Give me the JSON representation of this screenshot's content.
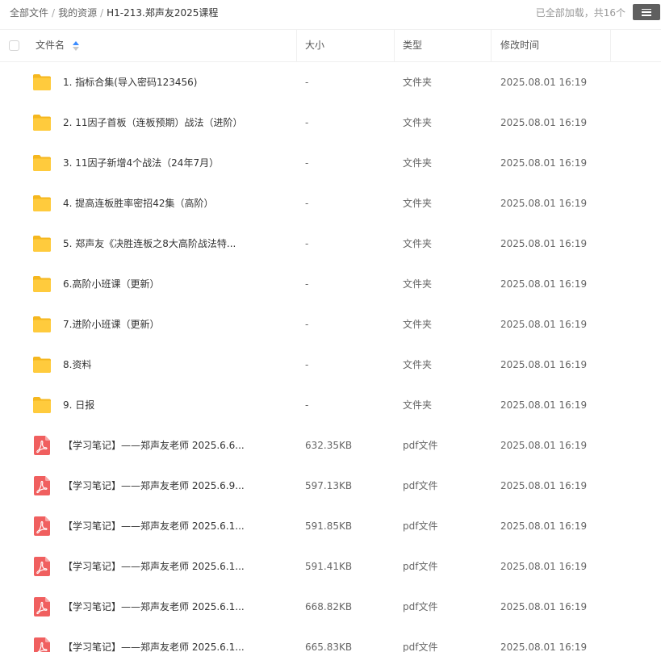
{
  "breadcrumb": {
    "items": [
      "全部文件",
      "我的资源"
    ],
    "current": "H1-213.郑声友2025课程",
    "separator": "/"
  },
  "status": {
    "text": "已全部加载，共16个"
  },
  "menu_icon": "hamburger-menu-icon",
  "columns": {
    "name": "文件名",
    "size": "大小",
    "type": "类型",
    "mtime": "修改时间"
  },
  "colors": {
    "folder": "#ffcb3d",
    "pdf": "#f05f5f",
    "sort_accent": "#3b8cff"
  },
  "files": [
    {
      "icon": "folder-icon",
      "name": "1. 指标合集(导入密码123456)",
      "size": "-",
      "type": "文件夹",
      "mtime": "2025.08.01 16:19"
    },
    {
      "icon": "folder-icon",
      "name": "2. 11因子首板（连板预期）战法（进阶）",
      "size": "-",
      "type": "文件夹",
      "mtime": "2025.08.01 16:19"
    },
    {
      "icon": "folder-icon",
      "name": "3. 11因子新增4个战法（24年7月）",
      "size": "-",
      "type": "文件夹",
      "mtime": "2025.08.01 16:19"
    },
    {
      "icon": "folder-icon",
      "name": "4. 提高连板胜率密招42集（高阶）",
      "size": "-",
      "type": "文件夹",
      "mtime": "2025.08.01 16:19"
    },
    {
      "icon": "folder-icon",
      "name": "5. 郑声友《决胜连板之8大高阶战法特...",
      "size": "-",
      "type": "文件夹",
      "mtime": "2025.08.01 16:19"
    },
    {
      "icon": "folder-icon",
      "name": "6.高阶小班课（更新）",
      "size": "-",
      "type": "文件夹",
      "mtime": "2025.08.01 16:19"
    },
    {
      "icon": "folder-icon",
      "name": "7.进阶小班课（更新）",
      "size": "-",
      "type": "文件夹",
      "mtime": "2025.08.01 16:19"
    },
    {
      "icon": "folder-icon",
      "name": "8.资料",
      "size": "-",
      "type": "文件夹",
      "mtime": "2025.08.01 16:19"
    },
    {
      "icon": "folder-icon",
      "name": "9. 日报",
      "size": "-",
      "type": "文件夹",
      "mtime": "2025.08.01 16:19"
    },
    {
      "icon": "pdf-icon",
      "name": "【学习笔记】——郑声友老师 2025.6.6...",
      "size": "632.35KB",
      "type": "pdf文件",
      "mtime": "2025.08.01 16:19"
    },
    {
      "icon": "pdf-icon",
      "name": "【学习笔记】——郑声友老师 2025.6.9...",
      "size": "597.13KB",
      "type": "pdf文件",
      "mtime": "2025.08.01 16:19"
    },
    {
      "icon": "pdf-icon",
      "name": "【学习笔记】——郑声友老师 2025.6.1...",
      "size": "591.85KB",
      "type": "pdf文件",
      "mtime": "2025.08.01 16:19"
    },
    {
      "icon": "pdf-icon",
      "name": "【学习笔记】——郑声友老师 2025.6.1...",
      "size": "591.41KB",
      "type": "pdf文件",
      "mtime": "2025.08.01 16:19"
    },
    {
      "icon": "pdf-icon",
      "name": "【学习笔记】——郑声友老师 2025.6.1...",
      "size": "668.82KB",
      "type": "pdf文件",
      "mtime": "2025.08.01 16:19"
    },
    {
      "icon": "pdf-icon",
      "name": "【学习笔记】——郑声友老师 2025.6.1...",
      "size": "665.83KB",
      "type": "pdf文件",
      "mtime": "2025.08.01 16:19"
    }
  ]
}
